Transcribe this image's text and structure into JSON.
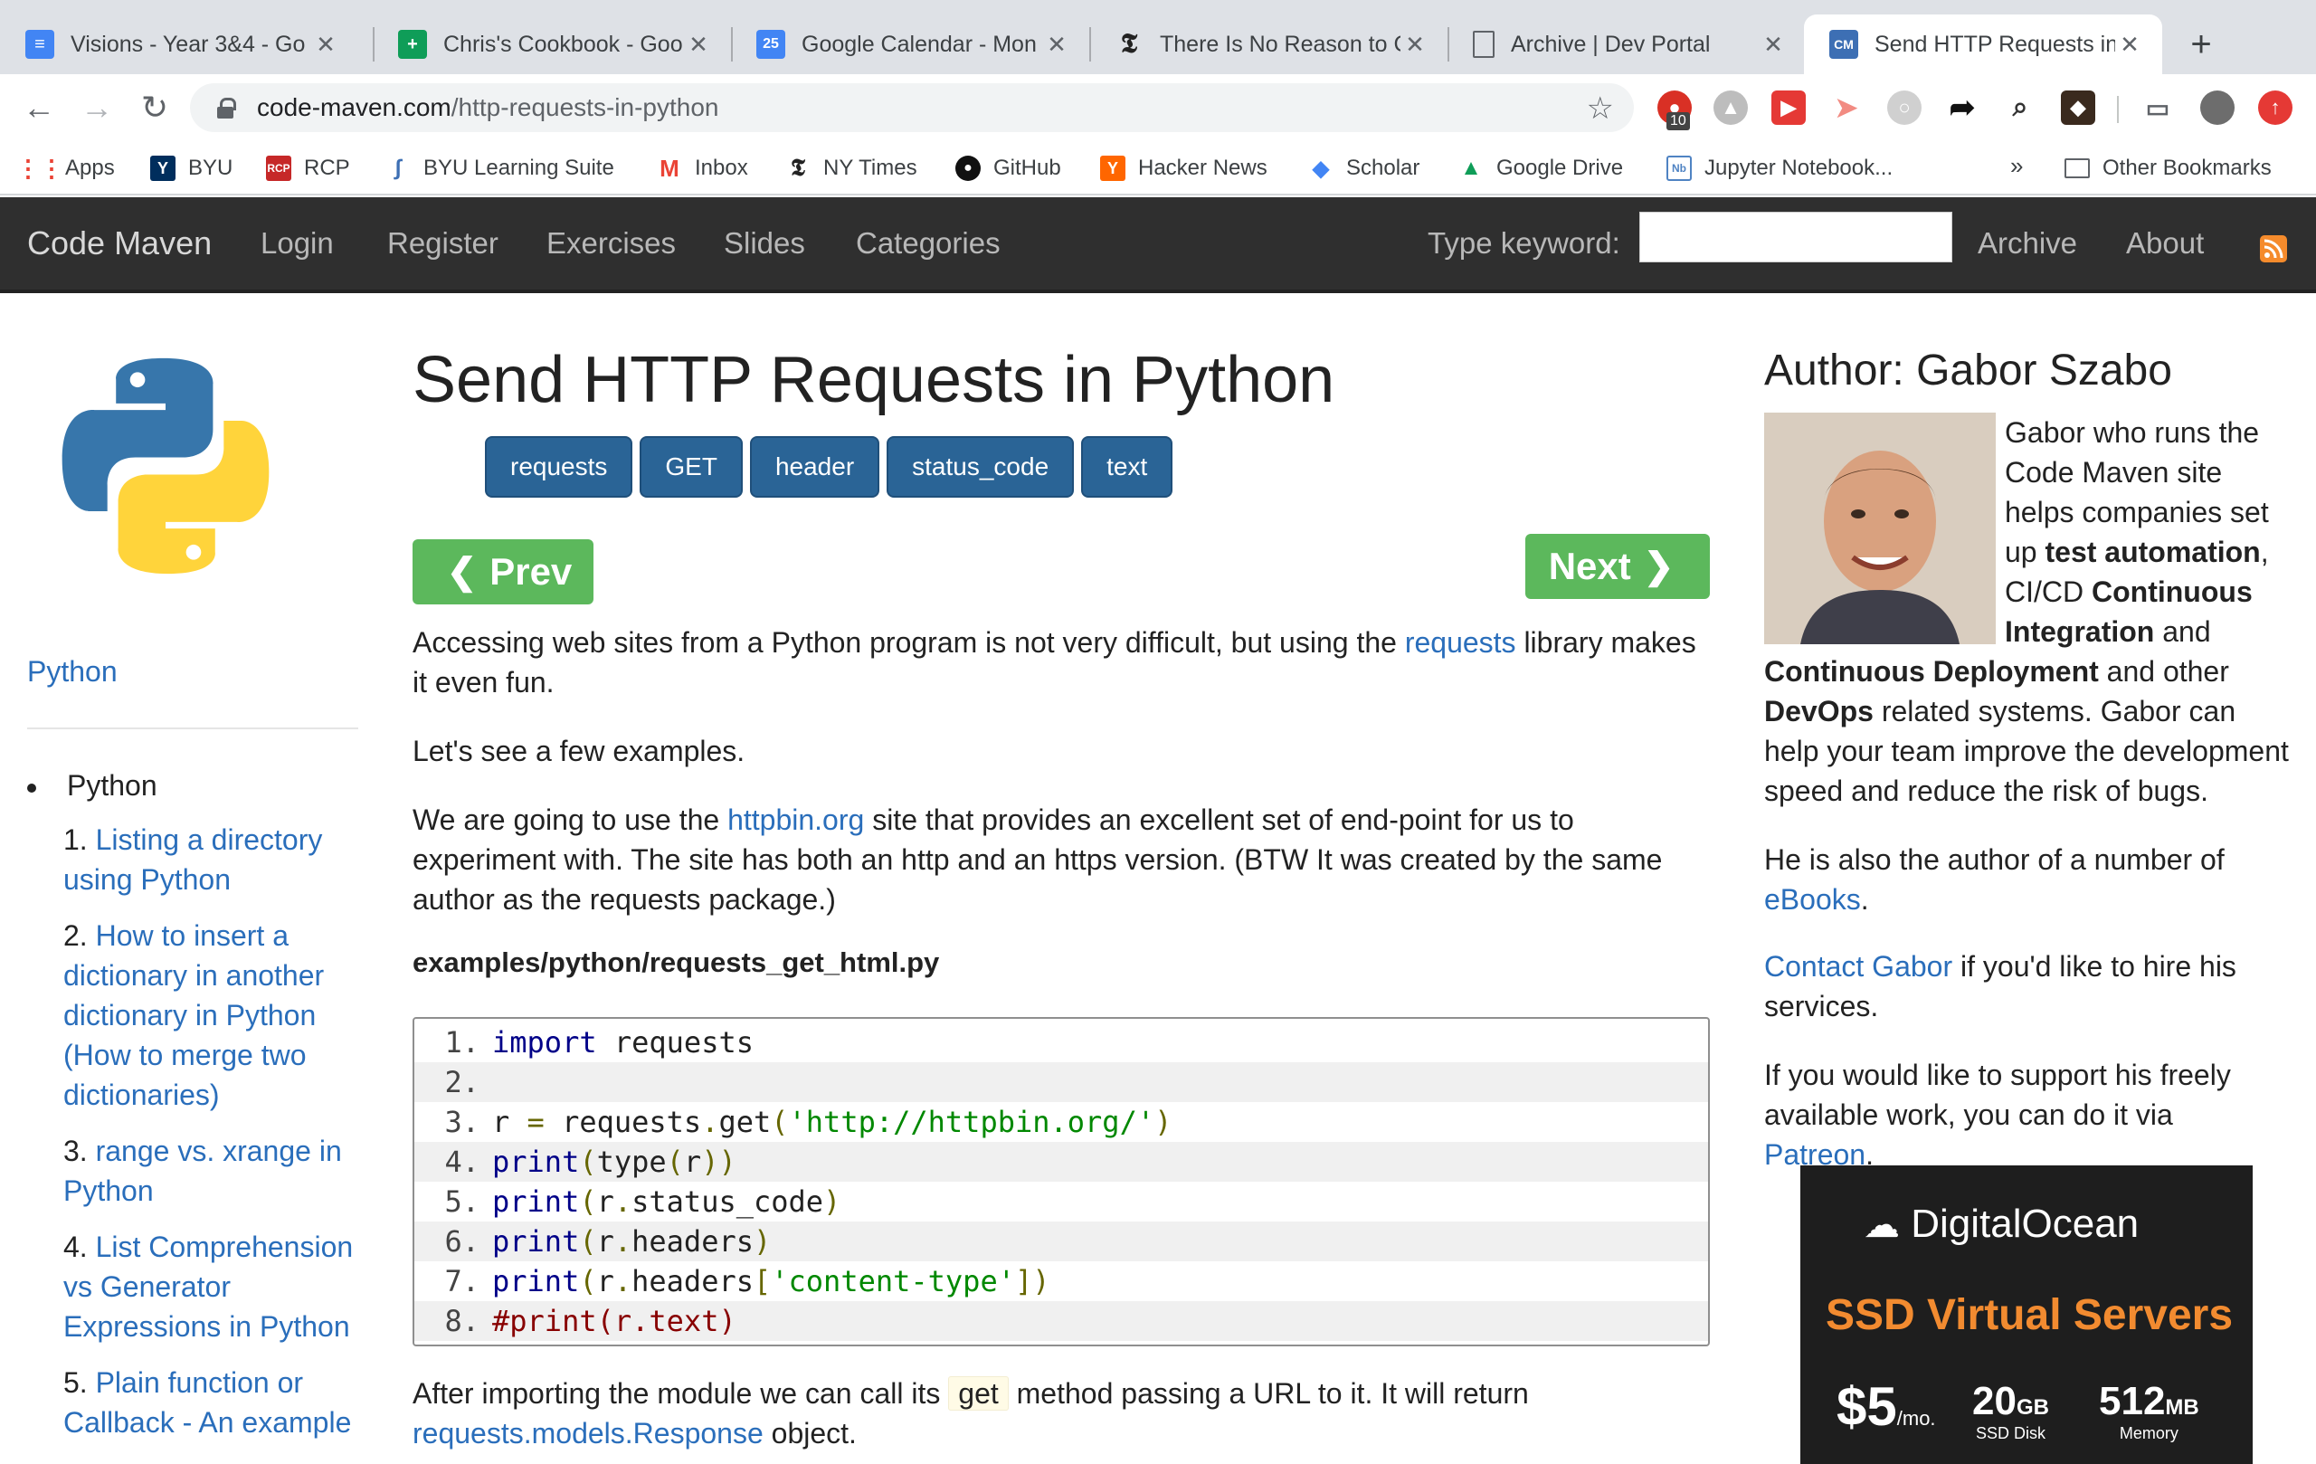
{
  "browser": {
    "tabs": [
      {
        "title": "Visions - Year 3&4 - Go",
        "icon": "docs-icon",
        "color": "#4285f4"
      },
      {
        "title": "Chris's Cookbook - Goo",
        "icon": "sheets-icon",
        "color": "#0f9d58"
      },
      {
        "title": "Google Calendar - Mon",
        "icon": "calendar-icon",
        "color": "#4285f4",
        "glyph": "25"
      },
      {
        "title": "There Is No Reason to C",
        "icon": "nytimes-icon",
        "color": "#222222"
      },
      {
        "title": "Archive | Dev Portal",
        "icon": "page-icon",
        "color": "#ffffff"
      },
      {
        "title": "Send HTTP Requests in",
        "icon": "codemaven-icon",
        "color": "#3d6fb4",
        "active": true
      }
    ],
    "url_host": "code-maven.com",
    "url_path": "/http-requests-in-python",
    "extension_badge": "10",
    "bookmarks": [
      {
        "label": "Apps",
        "icon": "apps-grid-icon"
      },
      {
        "label": "BYU",
        "icon": "byu-icon"
      },
      {
        "label": "RCP",
        "icon": "rcp-icon"
      },
      {
        "label": "BYU Learning Suite",
        "icon": "learning-suite-icon"
      },
      {
        "label": "Inbox",
        "icon": "gmail-icon"
      },
      {
        "label": "NY Times",
        "icon": "nytimes-icon"
      },
      {
        "label": "GitHub",
        "icon": "github-icon"
      },
      {
        "label": "Hacker News",
        "icon": "hackernews-icon"
      },
      {
        "label": "Scholar",
        "icon": "scholar-icon"
      },
      {
        "label": "Google Drive",
        "icon": "drive-icon"
      },
      {
        "label": "Jupyter Notebook...",
        "icon": "jupyter-icon"
      }
    ],
    "more_bookmarks": "»",
    "other_bookmarks": "Other Bookmarks"
  },
  "site": {
    "brand": "Code Maven",
    "nav": [
      "Login",
      "Register",
      "Exercises",
      "Slides",
      "Categories"
    ],
    "keyword_label": "Type keyword:",
    "keyword_value": "",
    "right_nav": [
      "Archive",
      "About"
    ]
  },
  "left_sidebar": {
    "category_link": "Python",
    "list_heading": "Python",
    "items": [
      {
        "num": "1.",
        "text": "Listing a directory using Python"
      },
      {
        "num": "2.",
        "text": "How to insert a dictionary in another dictionary in Python (How to merge two dictionaries)"
      },
      {
        "num": "3.",
        "text": "range vs. xrange in Python"
      },
      {
        "num": "4.",
        "text": "List Comprehension vs Generator Expressions in Python"
      },
      {
        "num": "5.",
        "text": "Plain function or Callback - An example"
      }
    ]
  },
  "article": {
    "title": "Send HTTP Requests in Python",
    "tags": [
      "requests",
      "GET",
      "header",
      "status_code",
      "text"
    ],
    "prev_label": "Prev",
    "next_label": "Next",
    "p1_before": "Accessing web sites from a Python program is not very difficult, but using the ",
    "p1_link": "requests",
    "p1_after": " library makes it even fun.",
    "p2": "Let's see a few examples.",
    "p3_before": "We are going to use the ",
    "p3_link": "httpbin.org",
    "p3_after": " site that provides an excellent set of end-point for us to experiment with. The site has both an http and an https version. (BTW It was created by the same author as the requests package.)",
    "filename": "examples/python/requests_get_html.py",
    "code_lines": [
      {
        "n": "1.",
        "code": ""
      },
      {
        "n": "2.",
        "code": ""
      },
      {
        "n": "3.",
        "code": ""
      },
      {
        "n": "4.",
        "code": ""
      },
      {
        "n": "5.",
        "code": ""
      },
      {
        "n": "6.",
        "code": ""
      },
      {
        "n": "7.",
        "code": ""
      },
      {
        "n": "8.",
        "code": ""
      }
    ],
    "p4_before": "After importing the module we can call its ",
    "p4_code": "get",
    "p4_middle": " method passing a URL to it. It will return ",
    "p4_link": "requests.models.Response",
    "p4_after": " object."
  },
  "author": {
    "heading": "Author: Gabor Szabo",
    "bio_1": "Gabor who runs the Code Maven site helps companies set up ",
    "bio_b1": "test automation",
    "bio_2": ", CI/CD ",
    "bio_b2": "Continuous Integration",
    "bio_3": " and ",
    "bio_b3": "Continuous Deployment",
    "bio_4": " and other ",
    "bio_b4": "DevOps",
    "bio_5": " related systems. Gabor can help your team improve the development speed and reduce the risk of bugs.",
    "ebooks_before": "He is also the author of a number of ",
    "ebooks_link": "eBooks",
    "ebooks_after": ".",
    "contact_link": "Contact Gabor",
    "contact_after": " if you'd like to hire his services.",
    "support_before": "If you would like to support his freely available work, you can do it via ",
    "support_link": "Patreon",
    "support_after": "."
  },
  "ad": {
    "brand": "DigitalOcean",
    "headline": "SSD Virtual Servers",
    "price": "$5",
    "price_unit": "/mo.",
    "disk": "20",
    "disk_unit": "GB",
    "disk_label": "SSD Disk",
    "memory": "512",
    "memory_unit": "MB",
    "memory_label": "Memory"
  }
}
